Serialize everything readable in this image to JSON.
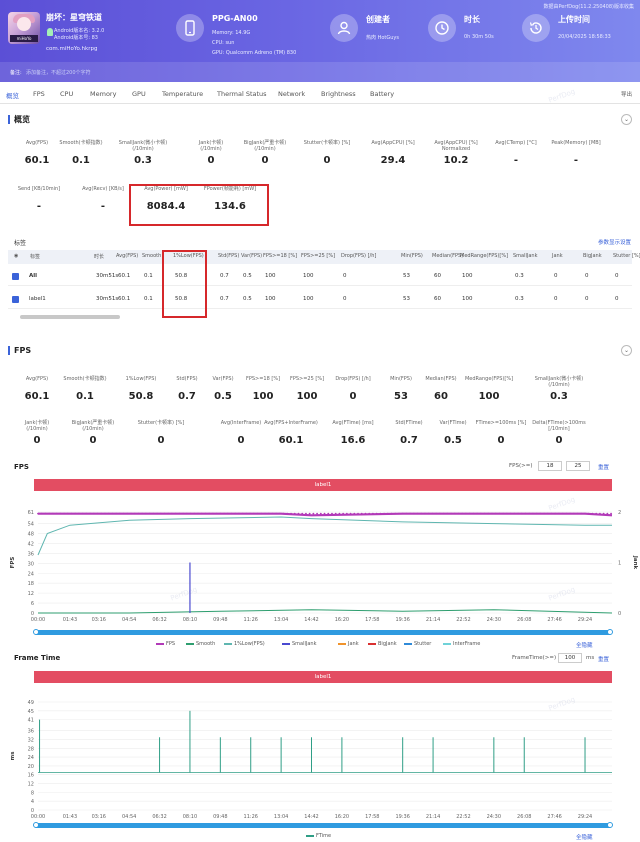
{
  "header": {
    "top_note": "数据由PerfDog(11.2.250408)版本收集",
    "app": {
      "name": "崩坏：星穹铁道",
      "android_version": "Android版本名: 3.2.0",
      "android_code": "Android版本号: 83",
      "package": "com.miHoYo.hkrpg",
      "logo_tag": "miHoYo"
    },
    "device": {
      "title": "PPG-AN00",
      "memory": "Memory: 14.9G",
      "cpu": "CPU: sun",
      "gpu": "GPU: Qualcomm Adreno (TM) 830"
    },
    "creator": {
      "title": "创建者",
      "value": "热肉 HotGuys"
    },
    "duration": {
      "title": "时长",
      "value": "0h 30m 50s"
    },
    "upload": {
      "title": "上传时间",
      "value": "20/04/2025 18:58:33"
    },
    "remark_label": "备注:",
    "remark_placeholder": "添加备注，不超过200个字符"
  },
  "tabs": [
    "概览",
    "FPS",
    "CPU",
    "Memory",
    "GPU",
    "Temperature",
    "Thermal Status",
    "Network",
    "Brightness",
    "Battery"
  ],
  "export_label": "导出",
  "overview": {
    "title": "概览",
    "metrics_row1": [
      {
        "label": "Avg(FPS)",
        "value": "60.1"
      },
      {
        "label": "Smooth(卡顿指数)",
        "value": "0.1"
      },
      {
        "label": "SmallJank(微小卡顿)\n(/10min)",
        "value": "0.3"
      },
      {
        "label": "Jank(卡顿)\n(/10min)",
        "value": "0"
      },
      {
        "label": "BigJank(严重卡顿)\n(/10min)",
        "value": "0"
      },
      {
        "label": "Stutter(卡顿率) [%]",
        "value": "0"
      },
      {
        "label": "Avg(AppCPU) [%]",
        "value": "29.4"
      },
      {
        "label": "Avg(AppCPU) [%]\nNormalized",
        "value": "10.2"
      },
      {
        "label": "Avg(CTemp) [°C]",
        "value": "-"
      },
      {
        "label": "Peak(Memory) [MB]",
        "value": "-"
      }
    ],
    "metrics_row2": [
      {
        "label": "Send [KB/10min]",
        "value": "-"
      },
      {
        "label": "Avg(Recv) [KB/s]",
        "value": "-"
      },
      {
        "label": "Avg(Power) [mW]",
        "value": "8084.4"
      },
      {
        "label": "FPower(帧能耗) [mW]",
        "value": "134.6"
      }
    ]
  },
  "table": {
    "section_label": "标签",
    "settings_link": "参数显示设置",
    "columns": [
      "标签",
      "时长",
      "Avg(FPS)",
      "Smooth",
      "1%Low(FPS)",
      "Std(FPS)",
      "Var(FPS)",
      "FPS>=18 [%]",
      "FPS>=25 [%]",
      "Drop(FPS) [/h]",
      "Min(FPS)",
      "Median(FPS)",
      "MedRange(FPS)[%]",
      "SmallJank\n(/10min)",
      "Jank\n(/10min)",
      "BigJank\n(/10min)",
      "Stutter [%]"
    ],
    "rows": [
      [
        "All",
        "30m51s",
        "60.1",
        "0.1",
        "50.8",
        "0.7",
        "0.5",
        "100",
        "100",
        "0",
        "53",
        "60",
        "100",
        "0.3",
        "0",
        "0",
        "0"
      ],
      [
        "label1",
        "30m51s",
        "60.1",
        "0.1",
        "50.8",
        "0.7",
        "0.5",
        "100",
        "100",
        "0",
        "53",
        "60",
        "100",
        "0.3",
        "0",
        "0",
        "0"
      ]
    ]
  },
  "fps_section": {
    "title": "FPS",
    "metrics_row1": [
      {
        "label": "Avg(FPS)",
        "value": "60.1"
      },
      {
        "label": "Smooth(卡顿指数)",
        "value": "0.1"
      },
      {
        "label": "1%Low(FPS)",
        "value": "50.8"
      },
      {
        "label": "Std(FPS)",
        "value": "0.7"
      },
      {
        "label": "Var(FPS)",
        "value": "0.5"
      },
      {
        "label": "FPS>=18 [%]",
        "value": "100"
      },
      {
        "label": "FPS>=25 [%]",
        "value": "100"
      },
      {
        "label": "Drop(FPS) [/h]",
        "value": "0"
      },
      {
        "label": "Min(FPS)",
        "value": "53"
      },
      {
        "label": "Median(FPS)",
        "value": "60"
      },
      {
        "label": "MedRange(FPS)[%]",
        "value": "100"
      },
      {
        "label": "SmallJank(微小卡顿)\n(/10min)",
        "value": "0.3"
      }
    ],
    "metrics_row2": [
      {
        "label": "Jank(卡顿)\n(/10min)",
        "value": "0"
      },
      {
        "label": "BigJank(严重卡顿)\n(/10min)",
        "value": "0"
      },
      {
        "label": "Stutter(卡顿率) [%]",
        "value": "0"
      },
      {
        "label": "Avg(InterFrame)",
        "value": "0"
      },
      {
        "label": "Avg(FPS+InterFrame)",
        "value": "60.1"
      },
      {
        "label": "Avg(FTime) [ms]",
        "value": "16.6"
      },
      {
        "label": "Std(FTime)",
        "value": "0.7"
      },
      {
        "label": "Var(FTime)",
        "value": "0.5"
      },
      {
        "label": "FTime>=100ms [%]",
        "value": "0"
      },
      {
        "label": "Delta(FTime)>100ms [/10min]",
        "value": "0"
      }
    ]
  },
  "fps_chart": {
    "title": "FPS",
    "fps_threshold_label": "FPS(>=)",
    "fps_threshold_1": "18",
    "fps_threshold_2": "25",
    "reset_label": "重置",
    "band_label": "label1",
    "y_left_label": "FPS",
    "y_right_label": "Jank",
    "show_all": "全隐藏",
    "legend": [
      "FPS",
      "Smooth",
      "1%Low(FPS)",
      "SmallJank",
      "Jank",
      "BigJank",
      "Stutter",
      "InterFrame"
    ]
  },
  "ft_chart": {
    "title": "Frame Time",
    "threshold_label": "FrameTime(>=)",
    "threshold_value": "100",
    "threshold_unit": "ms",
    "reset_label": "重置",
    "band_label": "label1",
    "y_label": "ms",
    "show_all": "全隐藏",
    "legend": [
      "FTime"
    ]
  },
  "watermark": "PerfDog",
  "colors": {
    "accent": "#3b63d9",
    "header_start": "#5b4fd6",
    "highlight_box": "#d6282b",
    "fps_line": "#b23ab8",
    "smooth": "#2e9e6f",
    "low1": "#5fb6b0",
    "smalljank": "#4a4ad0",
    "jank": "#f0932b",
    "bigjank": "#d93030",
    "stutter": "#2f8ad8",
    "interframe": "#6fd2d8",
    "ftime": "#2f9e86",
    "label_band": "#e34d62"
  },
  "chart_data": [
    {
      "type": "line",
      "title": "FPS",
      "xlabel": "",
      "ylabel": "FPS",
      "y2label": "Jank",
      "x_ticks": [
        "00:00",
        "01:43",
        "03:16",
        "04:54",
        "06:32",
        "08:10",
        "09:48",
        "11:26",
        "13:04",
        "14:42",
        "16:20",
        "17:58",
        "19:36",
        "21:14",
        "22:52",
        "24:30",
        "26:08",
        "27:46",
        "29:24"
      ],
      "y_ticks": [
        0,
        6,
        12,
        18,
        24,
        30,
        36,
        42,
        48,
        54,
        61
      ],
      "y2_ticks": [
        0,
        1,
        2
      ],
      "ylim": [
        0,
        61
      ],
      "y2lim": [
        0,
        2
      ],
      "series": [
        {
          "name": "FPS",
          "x": [
            "00:00",
            "04:54",
            "09:48",
            "13:04",
            "14:42",
            "19:36",
            "24:30",
            "29:24",
            "30:51"
          ],
          "values": [
            60,
            60,
            60,
            60,
            59,
            60,
            60,
            60,
            59
          ]
        },
        {
          "name": "Smooth",
          "x": [
            "00:00",
            "01:43",
            "04:54",
            "09:48",
            "14:42",
            "19:36",
            "24:30",
            "30:51"
          ],
          "values": [
            0,
            0,
            0,
            1,
            2,
            1,
            2,
            0
          ]
        },
        {
          "name": "1%Low(FPS)",
          "x": [
            "00:00",
            "00:30",
            "01:43",
            "04:54",
            "08:10",
            "13:04",
            "14:42",
            "19:36",
            "24:30",
            "29:24",
            "30:51"
          ],
          "values": [
            35,
            48,
            53,
            56,
            57,
            58,
            57,
            55,
            54,
            53,
            53
          ]
        },
        {
          "name": "SmallJank",
          "x": [
            "08:10"
          ],
          "values": [
            1
          ]
        }
      ]
    },
    {
      "type": "line",
      "title": "Frame Time",
      "xlabel": "",
      "ylabel": "ms",
      "x_ticks": [
        "00:00",
        "01:43",
        "03:16",
        "04:54",
        "06:32",
        "08:10",
        "09:48",
        "11:26",
        "13:04",
        "14:42",
        "16:20",
        "17:58",
        "19:36",
        "21:14",
        "22:52",
        "24:30",
        "26:08",
        "27:46",
        "29:24"
      ],
      "y_ticks": [
        0,
        4,
        8,
        12,
        16,
        20,
        24,
        28,
        32,
        36,
        41,
        45,
        49
      ],
      "ylim": [
        0,
        49
      ],
      "series": [
        {
          "name": "FTime",
          "x": [
            "00:00",
            "00:05",
            "06:32",
            "08:10",
            "09:48",
            "11:26",
            "13:04",
            "14:42",
            "16:20",
            "19:36",
            "21:14",
            "24:30",
            "26:08",
            "29:24"
          ],
          "values": [
            17,
            41,
            33,
            45,
            33,
            33,
            33,
            33,
            33,
            33,
            33,
            33,
            33,
            33
          ]
        }
      ]
    }
  ]
}
